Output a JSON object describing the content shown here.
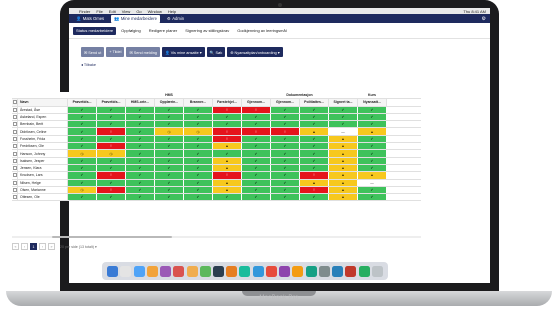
{
  "menubar": {
    "items": [
      "Finder",
      "File",
      "Edit",
      "View",
      "Go",
      "Window",
      "Help"
    ],
    "status": "Thu 8:41 AM"
  },
  "topbar": {
    "items": [
      {
        "label": "Mats Omes",
        "icon": "user-icon",
        "active": false
      },
      {
        "label": "Mine medarbeidere",
        "icon": "users-icon",
        "active": true
      },
      {
        "label": "Admin",
        "icon": "gear-icon",
        "active": false
      }
    ]
  },
  "subnav": {
    "items": [
      {
        "label": "Status medarbeidere",
        "active": true
      },
      {
        "label": "Oppfølging",
        "active": false
      },
      {
        "label": "Redigere planer",
        "active": false
      },
      {
        "label": "Signering av stillingskrav",
        "active": false
      },
      {
        "label": "Godkjenning av leeringsmål",
        "active": false
      }
    ]
  },
  "actions": [
    {
      "label": "✉ Send ut",
      "disabled": true
    },
    {
      "label": "+ Tildel",
      "disabled": true
    },
    {
      "label": "✉ Send melding",
      "disabled": true
    },
    {
      "label": "👤 Vis mine ansatte ▾",
      "disabled": false
    },
    {
      "label": "🔍 Søk",
      "disabled": false
    },
    {
      "label": "⊕ Nyansattplan/onboarding ▾",
      "disabled": false
    }
  ],
  "back_label": "◂ Tilbake",
  "table": {
    "groups": [
      {
        "label": "",
        "span": 3
      },
      {
        "label": "HMS",
        "span": 5
      },
      {
        "label": "Dokumentasjon",
        "span": 4
      },
      {
        "label": "Kurs",
        "span": 1
      }
    ],
    "headers": [
      "Navn",
      "Prøvetids...",
      "Prøvetids...",
      "HMS-orie...",
      "Opplærin...",
      "Branner...",
      "Førstehjel...",
      "Gjennom...",
      "Gjennom...",
      "Politiattes...",
      "Signert ta...",
      "Nyansatt..."
    ],
    "rows": [
      {
        "name": "Årestad, Åse",
        "cells": [
          "g",
          "g",
          "g",
          "g",
          "g",
          "r",
          "r",
          "g",
          "g",
          "g",
          "g"
        ]
      },
      {
        "name": "Askeland, Espen",
        "cells": [
          "g",
          "g",
          "g",
          "g",
          "g",
          "g",
          "g",
          "g",
          "g",
          "g",
          "g"
        ]
      },
      {
        "name": "Bernbain, Berit",
        "cells": [
          "g",
          "g",
          "g",
          "g",
          "g",
          "g",
          "g",
          "g",
          "g",
          "g",
          "g"
        ]
      },
      {
        "name": "Didriksen, Celine",
        "cells": [
          "g",
          "r",
          "g",
          "y",
          "y",
          "r",
          "r",
          "r",
          "y",
          "w",
          "y"
        ]
      },
      {
        "name": "Fosshelm, Frida",
        "cells": [
          "g",
          "g",
          "g",
          "g",
          "g",
          "r",
          "g",
          "g",
          "g",
          "y",
          "g"
        ]
      },
      {
        "name": "Fredriksen, Ole",
        "cells": [
          "g",
          "r",
          "g",
          "g",
          "g",
          "y",
          "g",
          "g",
          "g",
          "y",
          "g"
        ]
      },
      {
        "name": "Hanson, Johnny",
        "cells": [
          "y",
          "y",
          "g",
          "g",
          "g",
          "g",
          "g",
          "g",
          "g",
          "y",
          "g"
        ]
      },
      {
        "name": "Isaksen, Jesper",
        "cells": [
          "g",
          "g",
          "g",
          "g",
          "g",
          "y",
          "g",
          "g",
          "g",
          "y",
          "g"
        ]
      },
      {
        "name": "Jensen, Klara",
        "cells": [
          "g",
          "g",
          "g",
          "g",
          "g",
          "y",
          "g",
          "g",
          "g",
          "y",
          "g"
        ]
      },
      {
        "name": "Knudsen, Lars",
        "cells": [
          "g",
          "r",
          "g",
          "g",
          "g",
          "r",
          "g",
          "g",
          "r",
          "y",
          "y"
        ]
      },
      {
        "name": "Nilsen, Helge",
        "cells": [
          "g",
          "g",
          "g",
          "g",
          "g",
          "y",
          "g",
          "g",
          "y",
          "y",
          "w"
        ]
      },
      {
        "name": "Olsen, Marianne",
        "cells": [
          "y",
          "r",
          "g",
          "g",
          "g",
          "y",
          "g",
          "g",
          "r",
          "y",
          "g"
        ]
      },
      {
        "name": "Ottesen, Ole",
        "cells": [
          "g",
          "g",
          "g",
          "g",
          "g",
          "g",
          "g",
          "g",
          "g",
          "y",
          "g"
        ]
      }
    ]
  },
  "pager": {
    "buttons": [
      "«",
      "‹",
      "1",
      "›",
      "»"
    ],
    "active_page": "1",
    "info": "20 per side (13 totalt) ▾"
  },
  "laptop_brand": "MacBook Pro",
  "colors": {
    "navy": "#1e2a5e",
    "green": "#3ec25b",
    "red": "#e5141c",
    "yellow": "#f7c81e"
  }
}
